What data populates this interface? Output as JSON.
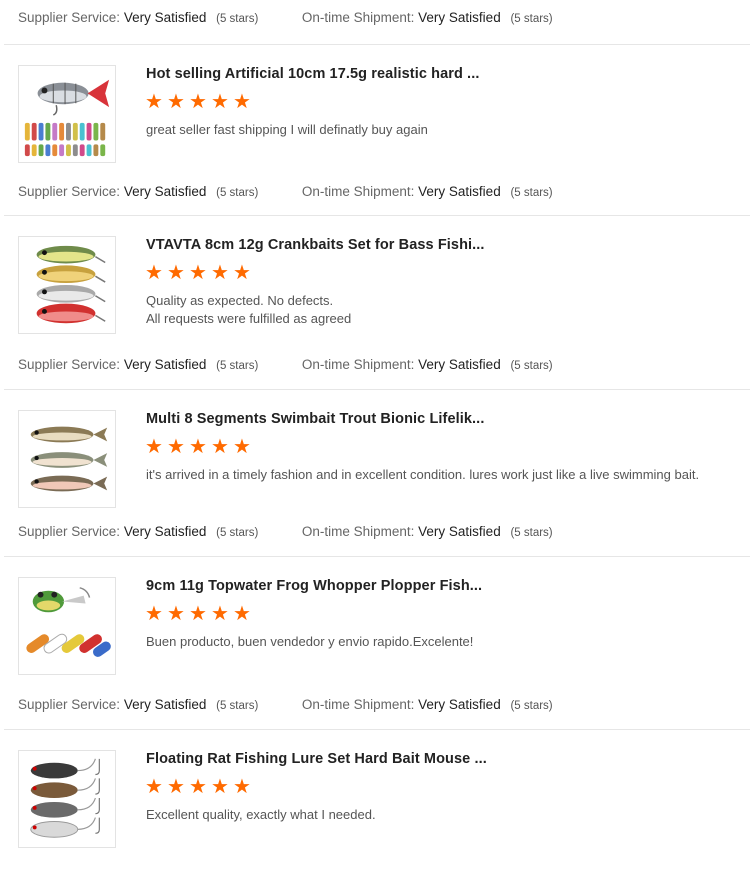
{
  "labels": {
    "supplier_service": "Supplier Service:",
    "ontime_shipment": "On-time Shipment:",
    "very_satisfied": "Very Satisfied",
    "five_stars": "(5 stars)"
  },
  "star_glyph": "★",
  "accent_color": "#ff6a00",
  "reviews": [
    {
      "title": "Hot selling Artificial 10cm 17.5g realistic hard ...",
      "rating": 5,
      "comment": [
        "great seller fast shipping I will definatly buy again"
      ],
      "thumb_icon": "segmented-swimbait-lure-icon"
    },
    {
      "title": "VTAVTA 8cm 12g Crankbaits Set for Bass Fishi...",
      "rating": 5,
      "comment": [
        "Quality as expected. No defects.",
        "All requests were fulfilled as agreed"
      ],
      "thumb_icon": "crankbait-set-icon"
    },
    {
      "title": "Multi 8 Segments Swimbait Trout Bionic Lifelik...",
      "rating": 5,
      "comment": [
        "it's arrived in a timely fashion and in excellent condition. lures work just like a live swimming bait."
      ],
      "thumb_icon": "trout-swimbait-icon"
    },
    {
      "title": "9cm 11g Topwater Frog Whopper Plopper Fish...",
      "rating": 5,
      "comment": [
        "Buen producto, buen vendedor y envio rapido.Excelente!"
      ],
      "thumb_icon": "topwater-frog-lure-icon"
    },
    {
      "title": "Floating Rat Fishing Lure Set Hard Bait Mouse ...",
      "rating": 5,
      "comment": [
        "Excellent quality, exactly what I needed."
      ],
      "thumb_icon": "rat-lure-set-icon"
    }
  ]
}
